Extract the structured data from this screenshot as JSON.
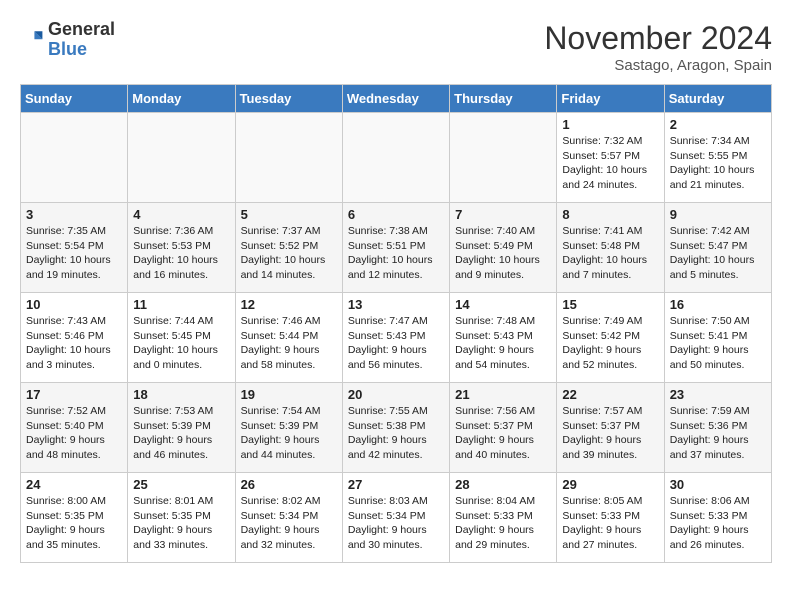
{
  "logo": {
    "text1": "General",
    "text2": "Blue"
  },
  "title": "November 2024",
  "location": "Sastago, Aragon, Spain",
  "weekdays": [
    "Sunday",
    "Monday",
    "Tuesday",
    "Wednesday",
    "Thursday",
    "Friday",
    "Saturday"
  ],
  "weeks": [
    [
      {
        "day": "",
        "info": ""
      },
      {
        "day": "",
        "info": ""
      },
      {
        "day": "",
        "info": ""
      },
      {
        "day": "",
        "info": ""
      },
      {
        "day": "",
        "info": ""
      },
      {
        "day": "1",
        "info": "Sunrise: 7:32 AM\nSunset: 5:57 PM\nDaylight: 10 hours\nand 24 minutes."
      },
      {
        "day": "2",
        "info": "Sunrise: 7:34 AM\nSunset: 5:55 PM\nDaylight: 10 hours\nand 21 minutes."
      }
    ],
    [
      {
        "day": "3",
        "info": "Sunrise: 7:35 AM\nSunset: 5:54 PM\nDaylight: 10 hours\nand 19 minutes."
      },
      {
        "day": "4",
        "info": "Sunrise: 7:36 AM\nSunset: 5:53 PM\nDaylight: 10 hours\nand 16 minutes."
      },
      {
        "day": "5",
        "info": "Sunrise: 7:37 AM\nSunset: 5:52 PM\nDaylight: 10 hours\nand 14 minutes."
      },
      {
        "day": "6",
        "info": "Sunrise: 7:38 AM\nSunset: 5:51 PM\nDaylight: 10 hours\nand 12 minutes."
      },
      {
        "day": "7",
        "info": "Sunrise: 7:40 AM\nSunset: 5:49 PM\nDaylight: 10 hours\nand 9 minutes."
      },
      {
        "day": "8",
        "info": "Sunrise: 7:41 AM\nSunset: 5:48 PM\nDaylight: 10 hours\nand 7 minutes."
      },
      {
        "day": "9",
        "info": "Sunrise: 7:42 AM\nSunset: 5:47 PM\nDaylight: 10 hours\nand 5 minutes."
      }
    ],
    [
      {
        "day": "10",
        "info": "Sunrise: 7:43 AM\nSunset: 5:46 PM\nDaylight: 10 hours\nand 3 minutes."
      },
      {
        "day": "11",
        "info": "Sunrise: 7:44 AM\nSunset: 5:45 PM\nDaylight: 10 hours\nand 0 minutes."
      },
      {
        "day": "12",
        "info": "Sunrise: 7:46 AM\nSunset: 5:44 PM\nDaylight: 9 hours\nand 58 minutes."
      },
      {
        "day": "13",
        "info": "Sunrise: 7:47 AM\nSunset: 5:43 PM\nDaylight: 9 hours\nand 56 minutes."
      },
      {
        "day": "14",
        "info": "Sunrise: 7:48 AM\nSunset: 5:43 PM\nDaylight: 9 hours\nand 54 minutes."
      },
      {
        "day": "15",
        "info": "Sunrise: 7:49 AM\nSunset: 5:42 PM\nDaylight: 9 hours\nand 52 minutes."
      },
      {
        "day": "16",
        "info": "Sunrise: 7:50 AM\nSunset: 5:41 PM\nDaylight: 9 hours\nand 50 minutes."
      }
    ],
    [
      {
        "day": "17",
        "info": "Sunrise: 7:52 AM\nSunset: 5:40 PM\nDaylight: 9 hours\nand 48 minutes."
      },
      {
        "day": "18",
        "info": "Sunrise: 7:53 AM\nSunset: 5:39 PM\nDaylight: 9 hours\nand 46 minutes."
      },
      {
        "day": "19",
        "info": "Sunrise: 7:54 AM\nSunset: 5:39 PM\nDaylight: 9 hours\nand 44 minutes."
      },
      {
        "day": "20",
        "info": "Sunrise: 7:55 AM\nSunset: 5:38 PM\nDaylight: 9 hours\nand 42 minutes."
      },
      {
        "day": "21",
        "info": "Sunrise: 7:56 AM\nSunset: 5:37 PM\nDaylight: 9 hours\nand 40 minutes."
      },
      {
        "day": "22",
        "info": "Sunrise: 7:57 AM\nSunset: 5:37 PM\nDaylight: 9 hours\nand 39 minutes."
      },
      {
        "day": "23",
        "info": "Sunrise: 7:59 AM\nSunset: 5:36 PM\nDaylight: 9 hours\nand 37 minutes."
      }
    ],
    [
      {
        "day": "24",
        "info": "Sunrise: 8:00 AM\nSunset: 5:35 PM\nDaylight: 9 hours\nand 35 minutes."
      },
      {
        "day": "25",
        "info": "Sunrise: 8:01 AM\nSunset: 5:35 PM\nDaylight: 9 hours\nand 33 minutes."
      },
      {
        "day": "26",
        "info": "Sunrise: 8:02 AM\nSunset: 5:34 PM\nDaylight: 9 hours\nand 32 minutes."
      },
      {
        "day": "27",
        "info": "Sunrise: 8:03 AM\nSunset: 5:34 PM\nDaylight: 9 hours\nand 30 minutes."
      },
      {
        "day": "28",
        "info": "Sunrise: 8:04 AM\nSunset: 5:33 PM\nDaylight: 9 hours\nand 29 minutes."
      },
      {
        "day": "29",
        "info": "Sunrise: 8:05 AM\nSunset: 5:33 PM\nDaylight: 9 hours\nand 27 minutes."
      },
      {
        "day": "30",
        "info": "Sunrise: 8:06 AM\nSunset: 5:33 PM\nDaylight: 9 hours\nand 26 minutes."
      }
    ]
  ]
}
